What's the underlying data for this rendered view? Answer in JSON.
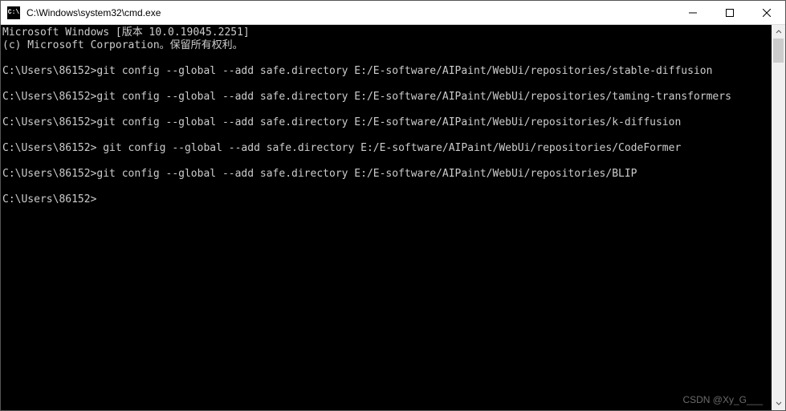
{
  "window": {
    "title": "C:\\Windows\\system32\\cmd.exe",
    "icon_label": "C:\\"
  },
  "terminal": {
    "header_line1": "Microsoft Windows [版本 10.0.19045.2251]",
    "header_line2": "(c) Microsoft Corporation。保留所有权利。",
    "prompt": "C:\\Users\\86152>",
    "commands": [
      "git config --global --add safe.directory E:/E-software/AIPaint/WebUi/repositories/stable-diffusion",
      "git config --global --add safe.directory E:/E-software/AIPaint/WebUi/repositories/taming-transformers",
      "git config --global --add safe.directory E:/E-software/AIPaint/WebUi/repositories/k-diffusion",
      " git config --global --add safe.directory E:/E-software/AIPaint/WebUi/repositories/CodeFormer",
      "git config --global --add safe.directory E:/E-software/AIPaint/WebUi/repositories/BLIP"
    ],
    "final_prompt": "C:\\Users\\86152>"
  },
  "watermark": "CSDN @Xy_G___"
}
